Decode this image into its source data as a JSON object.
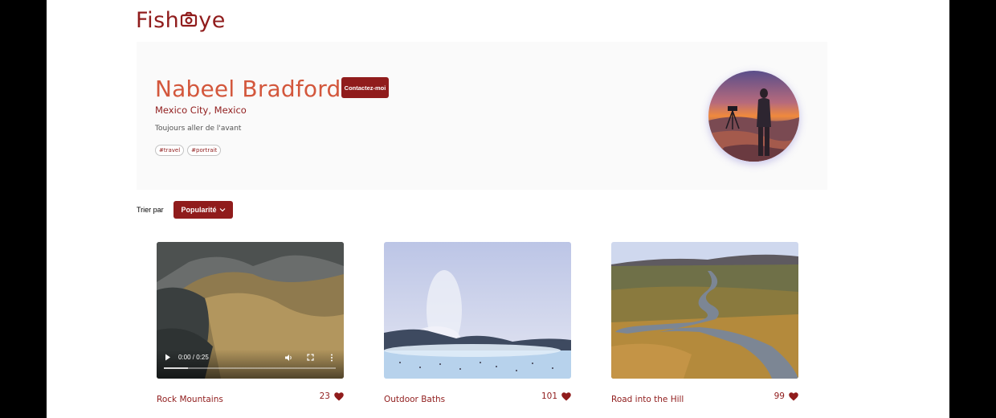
{
  "brand": {
    "logo_text_left": "Fish",
    "logo_text_right": "ye",
    "color": "#901c1c"
  },
  "photographer": {
    "name": "Nabeel Bradford",
    "location": "Mexico City, Mexico",
    "tagline": "Toujours aller de l'avant",
    "tags": [
      "#travel",
      "#portrait"
    ],
    "contact_label": "Contactez-moi"
  },
  "sort": {
    "label": "Trier par",
    "selected": "Popularité"
  },
  "media": [
    {
      "title": "Rock Mountains",
      "likes": "23",
      "type": "video",
      "time": "0:00 / 0:25",
      "progress": 0.14
    },
    {
      "title": "Outdoor Baths",
      "likes": "101",
      "type": "image"
    },
    {
      "title": "Road into the Hill",
      "likes": "99",
      "type": "image"
    }
  ],
  "colors": {
    "accent": "#901c1c",
    "name": "#d3573c",
    "header_bg": "#fafafa"
  },
  "icons": [
    "camera-icon",
    "chevron-down-icon",
    "heart-icon",
    "play-icon",
    "volume-icon",
    "fullscreen-icon",
    "more-icon"
  ]
}
